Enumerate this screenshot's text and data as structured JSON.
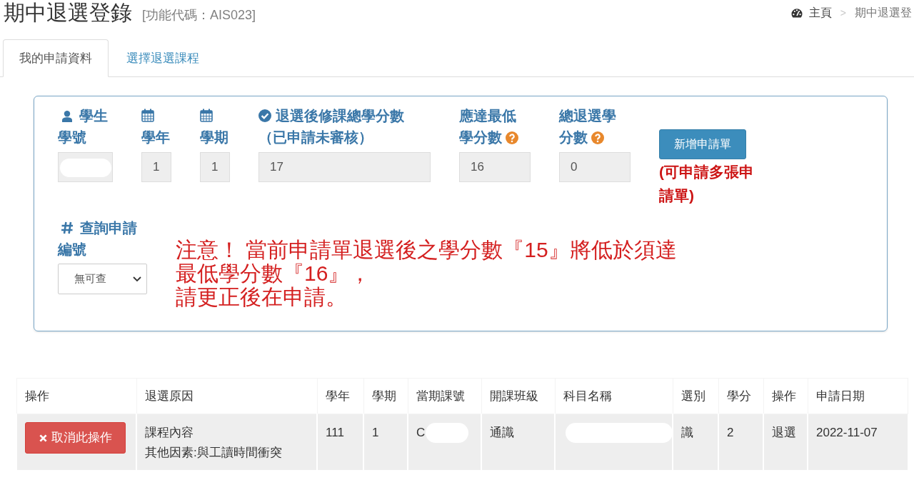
{
  "page_header": {
    "title": "期中退選登錄",
    "function_code": "[功能代碼：AIS023]"
  },
  "breadcrumb": {
    "items": [
      "主頁",
      "期中退選登"
    ],
    "separator": ">"
  },
  "tabs": [
    {
      "label": "我的申請資料",
      "selected": true
    },
    {
      "label": "選擇退選課程",
      "selected": false
    }
  ],
  "application_form": {
    "student_id": {
      "label_lines": [
        "學生",
        "學號"
      ]
    },
    "academic_year": {
      "label_lines": [
        "學年"
      ],
      "value": "1"
    },
    "semester": {
      "label_lines": [
        "學期"
      ],
      "value": "1"
    },
    "credits_after_drop": {
      "label_lines": [
        "退選後修課總學分數",
        "（已申請未審核）"
      ],
      "value": "17"
    },
    "minimum_credits": {
      "label_lines": [
        "應達最低",
        "學分數"
      ],
      "value": "16"
    },
    "total_dropped_credits": {
      "label_lines": [
        "總退選學",
        "分數"
      ],
      "value": "0"
    },
    "add_button": "新增申請單",
    "add_note": "(可申請多張申請單)",
    "query": {
      "label_lines": [
        "查詢申請",
        "編號"
      ],
      "value": "無可查"
    },
    "warning": [
      "注意！ 當前申請單退選後之學分數『15』將低於須達",
      "最低學分數『16』，",
      "請更正後在申請。"
    ]
  },
  "table": {
    "columns": [
      "操作",
      "退選原因",
      "學年",
      "學期",
      "當期課號",
      "開課班級",
      "科目名稱",
      "選別",
      "學分",
      "操作",
      "申請日期"
    ],
    "rows": [
      {
        "cancel_button": "取消此操作",
        "reason": [
          "課程內容",
          "其他因素:與工讀時間衝突"
        ],
        "academic_year": "111",
        "semester": "1",
        "course_code": "C",
        "class_group": "通識",
        "category": "識",
        "credits": "2",
        "operation": "退選",
        "apply_date": "2022-11-07"
      }
    ]
  }
}
